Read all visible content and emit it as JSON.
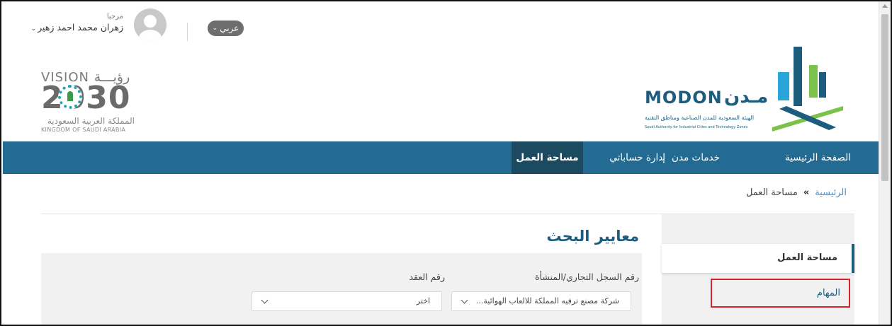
{
  "header": {
    "language_label": "عربي",
    "greeting": "مرحبا",
    "user_name": "زهران محمد احمد زهير",
    "vision_ar": "رؤيـــة",
    "vision_en": "VISION",
    "vision_year": "2030",
    "vision_country_ar": "المملكة العربية السعودية",
    "vision_country_en": "KINGDOM OF SAUDI ARABIA",
    "modon_en": "MODON",
    "modon_ar": "مـدن",
    "modon_sub_ar": "الهيئة السعودية للمدن الصناعية ومناطق التقنية",
    "modon_sub_en": "Saudi Authority for Industrial Cities and Technology Zones"
  },
  "nav": {
    "home": "الصفحة الرئيسية",
    "services": "خدمات مدن",
    "accounts": "إدارة حساباتي",
    "workspace": "مساحة العمل"
  },
  "breadcrumb": {
    "home": "الرئيسية",
    "separator": "»",
    "current": "مساحة العمل"
  },
  "sidebar": {
    "items": [
      {
        "label": "مساحة العمل"
      },
      {
        "label": "المهام"
      }
    ]
  },
  "main": {
    "title": "معايير البحث",
    "filters": {
      "registry_label": "رقم السجل التجاري/المنشأة",
      "registry_value": "شركة مصنع ترفيه المملكة للالعاب الهوائية...",
      "contract_label": "رقم العقد",
      "contract_value": "اختر"
    }
  },
  "colors": {
    "nav_bg": "#236b92",
    "nav_active_bg": "#1c4a60",
    "brand_blue": "#1c5d7e",
    "link_blue": "#4a8fc7",
    "highlight_red": "#d9232b"
  }
}
